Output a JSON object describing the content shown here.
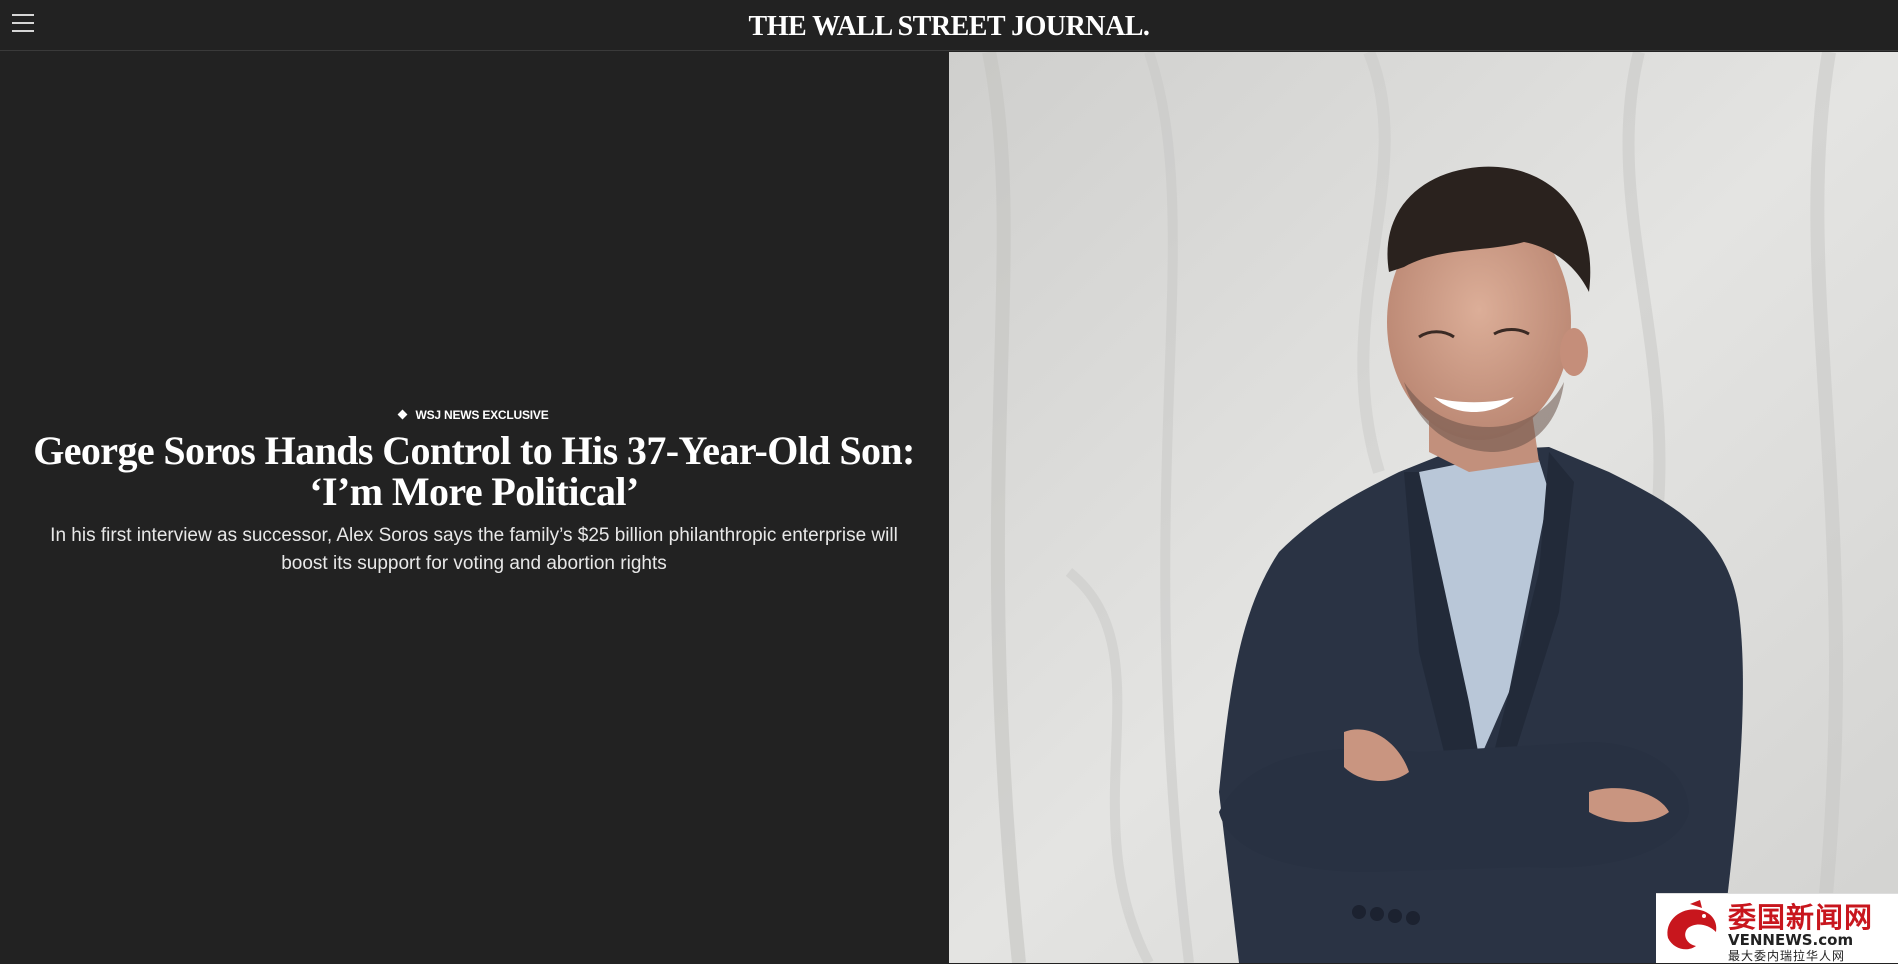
{
  "header": {
    "masthead": "THE WALL STREET JOURNAL.",
    "menu_icon": "hamburger-menu-icon"
  },
  "article": {
    "flashline": "WSJ NEWS EXCLUSIVE",
    "flashline_icon": "diamond-icon",
    "headline": "George Soros Hands Control to His 37-Year-Old Son: ‘I’m More Political’",
    "dek": "In his first interview as successor, Alex Soros says the family’s $25 billion philanthropic enterprise will boost its support for voting and abortion rights"
  },
  "watermark": {
    "chinese": "委国新闻网",
    "english": "VENNEWS.com",
    "subtitle": "最大委内瑞拉华人网"
  },
  "colors": {
    "background": "#222222",
    "text": "#ffffff",
    "watermark_red": "#c8161d"
  }
}
